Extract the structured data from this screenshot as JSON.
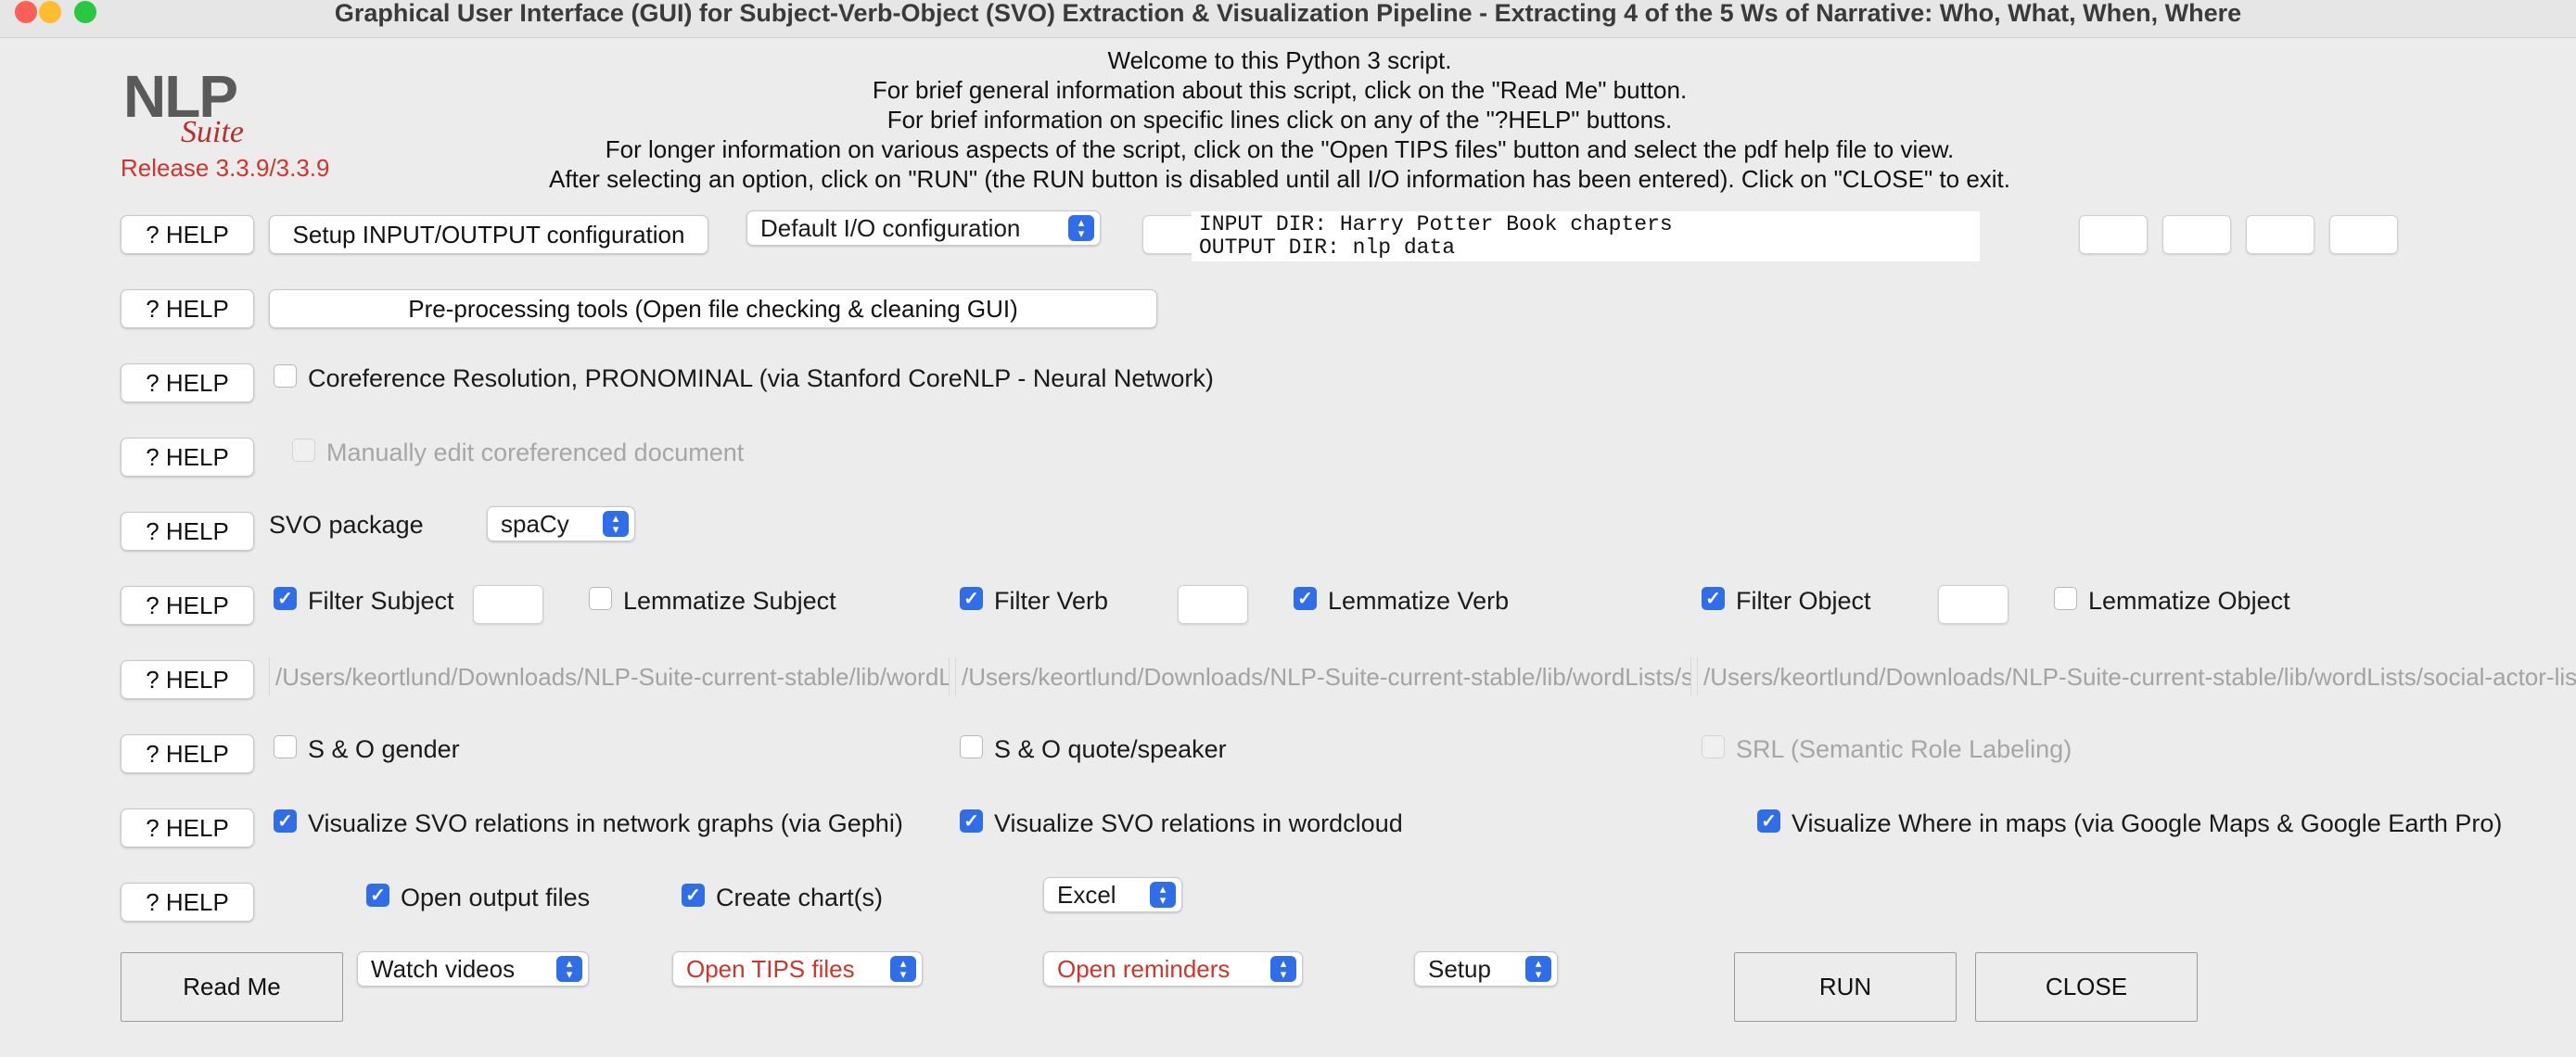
{
  "window": {
    "title": "Graphical User Interface (GUI) for Subject-Verb-Object (SVO) Extraction & Visualization Pipeline - Extracting 4 of the 5 Ws of Narrative: Who, What, When, Where",
    "traffic_lights": {
      "close": "#fe5f57",
      "minimize": "#febc2e",
      "zoom": "#28c840"
    }
  },
  "logo": {
    "nlp": "NLP",
    "suite": "Suite",
    "release": "Release 3.3.9/3.3.9"
  },
  "intro_lines": [
    "Welcome to this Python 3 script.",
    "For brief general information about this script, click on the \"Read Me\" button.",
    "For brief information on specific lines click on any of the \"?HELP\" buttons.",
    "For longer information on various aspects of the script, click on the \"Open TIPS files\" button and select the pdf help file to view.",
    "After selecting an option, click on \"RUN\" (the RUN button is disabled until all I/O information has been entered).   Click on \"CLOSE\" to exit."
  ],
  "help_label": "? HELP",
  "io": {
    "setup_button": "Setup INPUT/OUTPUT configuration",
    "config_dropdown": "Default I/O configuration",
    "input_dir": "INPUT DIR: Harry Potter Book chapters",
    "output_dir": "OUTPUT DIR: nlp data"
  },
  "preprocessing_button": "Pre-processing tools (Open file checking & cleaning GUI)",
  "coref": {
    "label": "Coreference Resolution, PRONOMINAL (via Stanford CoreNLP - Neural Network)",
    "checked": false
  },
  "manual_edit": {
    "label": "Manually edit coreferenced document",
    "checked": false,
    "enabled": false
  },
  "svo_package": {
    "label": "SVO package",
    "value": "spaCy"
  },
  "filters": {
    "filter_subject": {
      "label": "Filter Subject",
      "checked": true
    },
    "lemmatize_subject": {
      "label": "Lemmatize Subject",
      "checked": false
    },
    "filter_verb": {
      "label": "Filter Verb",
      "checked": true
    },
    "lemmatize_verb": {
      "label": "Lemmatize Verb",
      "checked": true
    },
    "filter_object": {
      "label": "Filter Object",
      "checked": true
    },
    "lemmatize_object": {
      "label": "Lemmatize Object",
      "checked": false
    }
  },
  "paths": {
    "subject": "/Users/keortlund/Downloads/NLP-Suite-current-stable/lib/wordLists/social-actor-list.csv",
    "verb": "/Users/keortlund/Downloads/NLP-Suite-current-stable/lib/wordLists/social-action-list.csv",
    "object": "/Users/keortlund/Downloads/NLP-Suite-current-stable/lib/wordLists/social-actor-list.csv"
  },
  "options": {
    "gender": {
      "label": "S & O gender",
      "checked": false
    },
    "quote": {
      "label": "S & O quote/speaker",
      "checked": false
    },
    "srl": {
      "label": "SRL (Semantic Role Labeling)",
      "checked": false,
      "enabled": false
    }
  },
  "visualize": {
    "gephi": {
      "label": "Visualize SVO relations in network graphs (via Gephi)",
      "checked": true
    },
    "wordcloud": {
      "label": "Visualize SVO relations in wordcloud",
      "checked": true
    },
    "maps": {
      "label": "Visualize Where in maps (via Google Maps & Google Earth Pro)",
      "checked": true
    }
  },
  "output": {
    "open_output": {
      "label": "Open output files",
      "checked": true
    },
    "create_charts": {
      "label": "Create chart(s)",
      "checked": true
    },
    "chart_package": "Excel"
  },
  "bottom": {
    "read_me": "Read Me",
    "watch_videos": "Watch videos",
    "open_tips": "Open TIPS files",
    "open_reminders": "Open reminders",
    "setup": "Setup",
    "run": "RUN",
    "close": "CLOSE"
  },
  "checkmark": "✓"
}
